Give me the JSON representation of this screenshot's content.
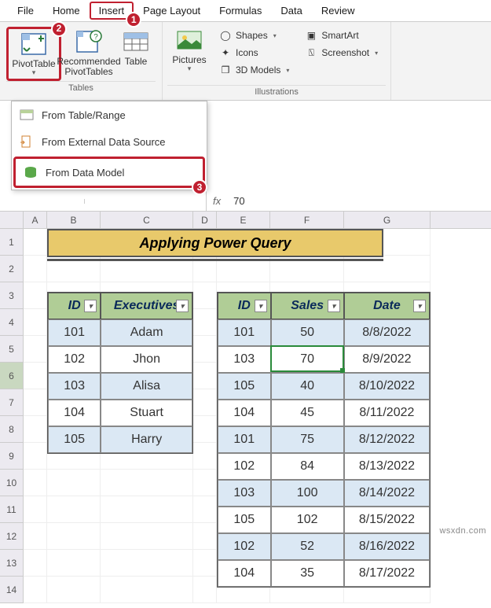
{
  "tabs": {
    "file": "File",
    "home": "Home",
    "insert": "Insert",
    "pagelayout": "Page Layout",
    "formulas": "Formulas",
    "data": "Data",
    "review": "Review"
  },
  "ribbon": {
    "pivottable": "PivotTable",
    "recommended": "Recommended PivotTables",
    "table": "Table",
    "tables_group": "Tables",
    "pictures": "Pictures",
    "shapes": "Shapes",
    "icons": "Icons",
    "models": "3D Models",
    "smartart": "SmartArt",
    "screenshot": "Screenshot",
    "illustrations_group": "Illustrations"
  },
  "dropdown": {
    "fromtable": "From Table/Range",
    "fromext": "From External Data Source",
    "fromdm": "From Data Model"
  },
  "callouts": {
    "c1": "1",
    "c2": "2",
    "c3": "3"
  },
  "formula": {
    "namebox": "",
    "fx": "fx",
    "value": "70"
  },
  "cols": {
    "A": "A",
    "B": "B",
    "C": "C",
    "D": "D",
    "E": "E",
    "F": "F",
    "G": "G"
  },
  "rownums": [
    "1",
    "2",
    "3",
    "4",
    "5",
    "6",
    "7",
    "8",
    "9",
    "10",
    "11",
    "12",
    "13",
    "14"
  ],
  "title": "Applying Power Query",
  "t1": {
    "h1": "ID",
    "h2": "Executives",
    "rows": [
      [
        "101",
        "Adam"
      ],
      [
        "102",
        "Jhon"
      ],
      [
        "103",
        "Alisa"
      ],
      [
        "104",
        "Stuart"
      ],
      [
        "105",
        "Harry"
      ]
    ]
  },
  "t2": {
    "h1": "ID",
    "h2": "Sales",
    "h3": "Date",
    "rows": [
      [
        "101",
        "50",
        "8/8/2022"
      ],
      [
        "103",
        "70",
        "8/9/2022"
      ],
      [
        "105",
        "40",
        "8/10/2022"
      ],
      [
        "104",
        "45",
        "8/11/2022"
      ],
      [
        "101",
        "75",
        "8/12/2022"
      ],
      [
        "102",
        "84",
        "8/13/2022"
      ],
      [
        "103",
        "100",
        "8/14/2022"
      ],
      [
        "105",
        "102",
        "8/15/2022"
      ],
      [
        "102",
        "52",
        "8/16/2022"
      ],
      [
        "104",
        "35",
        "8/17/2022"
      ]
    ]
  },
  "watermark": "wsxdn.com",
  "chart_data": {
    "type": "table",
    "tables": [
      {
        "title": "Executives",
        "columns": [
          "ID",
          "Executives"
        ],
        "rows": [
          [
            "101",
            "Adam"
          ],
          [
            "102",
            "Jhon"
          ],
          [
            "103",
            "Alisa"
          ],
          [
            "104",
            "Stuart"
          ],
          [
            "105",
            "Harry"
          ]
        ]
      },
      {
        "title": "Sales",
        "columns": [
          "ID",
          "Sales",
          "Date"
        ],
        "rows": [
          [
            "101",
            50,
            "8/8/2022"
          ],
          [
            "103",
            70,
            "8/9/2022"
          ],
          [
            "105",
            40,
            "8/10/2022"
          ],
          [
            "104",
            45,
            "8/11/2022"
          ],
          [
            "101",
            75,
            "8/12/2022"
          ],
          [
            "102",
            84,
            "8/13/2022"
          ],
          [
            "103",
            100,
            "8/14/2022"
          ],
          [
            "105",
            102,
            "8/15/2022"
          ],
          [
            "102",
            52,
            "8/16/2022"
          ],
          [
            "104",
            35,
            "8/17/2022"
          ]
        ]
      }
    ]
  }
}
